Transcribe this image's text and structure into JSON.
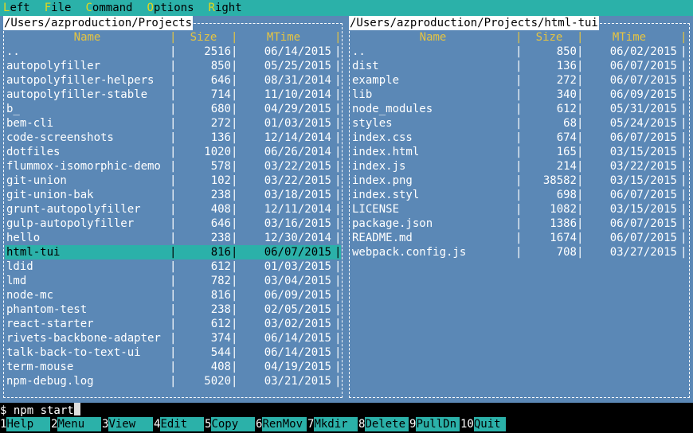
{
  "menu": [
    {
      "hot": "L",
      "rest": "eft"
    },
    {
      "hot": "F",
      "rest": "ile"
    },
    {
      "hot": "C",
      "rest": "ommand"
    },
    {
      "hot": "O",
      "rest": "ptions"
    },
    {
      "hot": "R",
      "rest": "ight"
    }
  ],
  "columns": {
    "name": "Name",
    "size": "Size",
    "mtime": "MTime"
  },
  "left_panel": {
    "path": "/Users/azproduction/Projects",
    "selected_index": 14,
    "rows": [
      {
        "name": "..",
        "size": "2516",
        "mtime": "06/14/2015"
      },
      {
        "name": "autopolyfiller",
        "size": "850",
        "mtime": "05/25/2015"
      },
      {
        "name": "autopolyfiller-helpers",
        "size": "646",
        "mtime": "08/31/2014"
      },
      {
        "name": "autopolyfiller-stable",
        "size": "714",
        "mtime": "11/10/2014"
      },
      {
        "name": "b_",
        "size": "680",
        "mtime": "04/29/2015"
      },
      {
        "name": "bem-cli",
        "size": "272",
        "mtime": "01/03/2015"
      },
      {
        "name": "code-screenshots",
        "size": "136",
        "mtime": "12/14/2014"
      },
      {
        "name": "dotfiles",
        "size": "1020",
        "mtime": "06/26/2014"
      },
      {
        "name": "flummox-isomorphic-demo",
        "size": "578",
        "mtime": "03/22/2015"
      },
      {
        "name": "git-union",
        "size": "102",
        "mtime": "03/22/2015"
      },
      {
        "name": "git-union-bak",
        "size": "238",
        "mtime": "03/18/2015"
      },
      {
        "name": "grunt-autopolyfiller",
        "size": "408",
        "mtime": "12/11/2014"
      },
      {
        "name": "gulp-autopolyfiller",
        "size": "646",
        "mtime": "03/16/2015"
      },
      {
        "name": "hello",
        "size": "238",
        "mtime": "12/30/2014"
      },
      {
        "name": "html-tui",
        "size": "816",
        "mtime": "06/07/2015"
      },
      {
        "name": "ldid",
        "size": "612",
        "mtime": "01/03/2015"
      },
      {
        "name": "lmd",
        "size": "782",
        "mtime": "03/04/2015"
      },
      {
        "name": "node-mc",
        "size": "816",
        "mtime": "06/09/2015"
      },
      {
        "name": "phantom-test",
        "size": "238",
        "mtime": "02/05/2015"
      },
      {
        "name": "react-starter",
        "size": "612",
        "mtime": "03/02/2015"
      },
      {
        "name": "rivets-backbone-adapter",
        "size": "374",
        "mtime": "06/14/2015"
      },
      {
        "name": "talk-back-to-text-ui",
        "size": "544",
        "mtime": "06/14/2015"
      },
      {
        "name": "term-mouse",
        "size": "408",
        "mtime": "04/19/2015"
      },
      {
        "name": "npm-debug.log",
        "size": "5020",
        "mtime": "03/21/2015"
      }
    ]
  },
  "right_panel": {
    "path": "/Users/azproduction/Projects/html-tui",
    "rows": [
      {
        "name": "..",
        "size": "850",
        "mtime": "06/02/2015"
      },
      {
        "name": "dist",
        "size": "136",
        "mtime": "06/07/2015"
      },
      {
        "name": "example",
        "size": "272",
        "mtime": "06/07/2015"
      },
      {
        "name": "lib",
        "size": "340",
        "mtime": "06/09/2015"
      },
      {
        "name": "node_modules",
        "size": "612",
        "mtime": "05/31/2015"
      },
      {
        "name": "styles",
        "size": "68",
        "mtime": "05/24/2015"
      },
      {
        "name": "index.css",
        "size": "674",
        "mtime": "06/07/2015"
      },
      {
        "name": "index.html",
        "size": "165",
        "mtime": "03/15/2015"
      },
      {
        "name": "index.js",
        "size": "214",
        "mtime": "03/22/2015"
      },
      {
        "name": "index.png",
        "size": "38582",
        "mtime": "03/15/2015"
      },
      {
        "name": "index.styl",
        "size": "698",
        "mtime": "06/07/2015"
      },
      {
        "name": "LICENSE",
        "size": "1082",
        "mtime": "03/15/2015"
      },
      {
        "name": "package.json",
        "size": "1386",
        "mtime": "06/07/2015"
      },
      {
        "name": "README.md",
        "size": "1674",
        "mtime": "06/07/2015"
      },
      {
        "name": "webpack.config.js",
        "size": "708",
        "mtime": "03/27/2015"
      }
    ]
  },
  "command_line": {
    "prompt": "$ ",
    "value": "npm start"
  },
  "function_keys": [
    {
      "num": "1",
      "label": "Help"
    },
    {
      "num": "2",
      "label": "Menu"
    },
    {
      "num": "3",
      "label": "View"
    },
    {
      "num": "4",
      "label": "Edit"
    },
    {
      "num": "5",
      "label": "Copy"
    },
    {
      "num": "6",
      "label": "RenMov"
    },
    {
      "num": "7",
      "label": "Mkdir"
    },
    {
      "num": "8",
      "label": "Delete"
    },
    {
      "num": "9",
      "label": "PullDn"
    },
    {
      "num": "10",
      "label": "Quit"
    }
  ],
  "colors": {
    "panel_bg": "#5b88b6",
    "accent": "#2bb1a9",
    "header_text": "#e6c441",
    "hotkey": "#e8d81a"
  }
}
